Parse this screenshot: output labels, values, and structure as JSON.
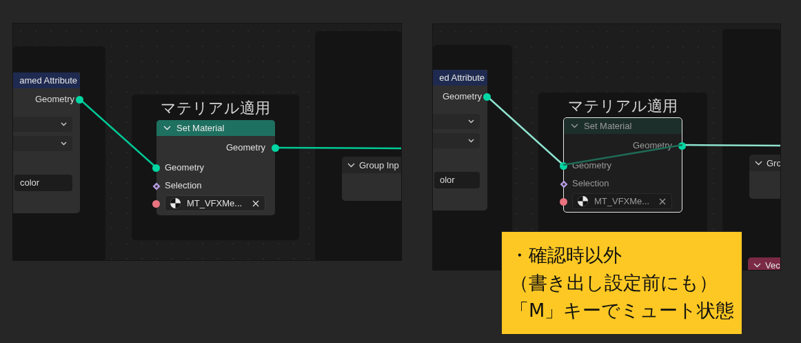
{
  "panels": [
    {
      "muted": false,
      "selected": false,
      "left_node": {
        "title": "amed Attribute",
        "output": "Geometry",
        "field": "color"
      },
      "frame": {
        "label": "マテリアル適用"
      },
      "node": {
        "title": "Set Material",
        "output": "Geometry",
        "inputs": [
          {
            "kind": "geometry",
            "label": "Geometry"
          },
          {
            "kind": "field",
            "label": "Selection"
          }
        ],
        "material": "MT_VFXMe..."
      },
      "right_node": {
        "title": "Group Inp"
      }
    },
    {
      "muted": true,
      "selected": true,
      "left_node": {
        "title": "ed Attribute",
        "output": "Geometry",
        "field": "olor"
      },
      "frame": {
        "label": "マテリアル適用"
      },
      "node": {
        "title": "Set Material",
        "output": "Geometry",
        "inputs": [
          {
            "kind": "geometry",
            "label": "Geometry"
          },
          {
            "kind": "field",
            "label": "Selection"
          }
        ],
        "material": "MT_VFXMe..."
      },
      "right_node": {
        "title": "Gro"
      },
      "bottom_node": {
        "title": "Vec"
      }
    }
  ],
  "callout": {
    "lines": [
      "・確認時以外",
      "（書き出し設定前にも）",
      "「M」キーでミュート状態"
    ]
  }
}
